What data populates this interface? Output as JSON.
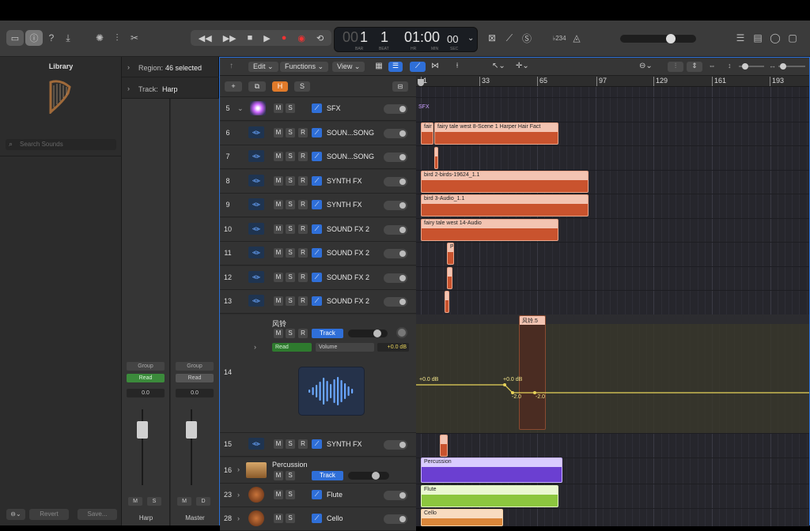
{
  "transport": {
    "bar_dim": "00",
    "bar": "1",
    "beat": "1",
    "time": "01:00",
    "time_small": "00",
    "labels": {
      "bar": "BAR",
      "beat": "BEAT",
      "hr": "HR",
      "min": "MIN",
      "sec": "SEC"
    },
    "key_label": "♭234"
  },
  "library": {
    "title": "Library",
    "search_placeholder": "Search Sounds",
    "revert_label": "Revert",
    "save_label": "Save..."
  },
  "inspector": {
    "region_label": "Region:",
    "region_value": "46 selected",
    "track_label": "Track:",
    "track_value": "Harp",
    "strips": [
      {
        "group": "Group",
        "automation": "Read",
        "value": "0.0",
        "m": "M",
        "s": "S",
        "name": "Harp"
      },
      {
        "group": "Group",
        "automation": "Read",
        "value": "0.0",
        "m": "M",
        "s": "D",
        "name": "Master"
      }
    ]
  },
  "tracks_toolbar": {
    "edit": "Edit",
    "functions": "Functions",
    "view": "View",
    "h_button": "H",
    "s_button": "S"
  },
  "ruler": {
    "ticks": [
      "1",
      "33",
      "65",
      "97",
      "129",
      "161",
      "193"
    ]
  },
  "tracks": [
    {
      "num": "5",
      "name": "SFX"
    },
    {
      "num": "6",
      "name": "SOUN...SONG"
    },
    {
      "num": "7",
      "name": "SOUN...SONG"
    },
    {
      "num": "8",
      "name": "SYNTH FX"
    },
    {
      "num": "9",
      "name": "SYNTH FX"
    },
    {
      "num": "10",
      "name": "SOUND FX 2"
    },
    {
      "num": "11",
      "name": "SOUND FX 2"
    },
    {
      "num": "12",
      "name": "SOUND FX 2"
    },
    {
      "num": "13",
      "name": "SOUND FX 2"
    }
  ],
  "expanded_track": {
    "num": "14",
    "name": "风铃",
    "track_btn": "Track",
    "mode": "Read",
    "param": "Volume",
    "param_value": "+0.0 dB"
  },
  "lower_tracks": [
    {
      "num": "15",
      "name": "SYNTH FX"
    },
    {
      "num": "16",
      "name": "Percussion",
      "track_btn": "Track"
    },
    {
      "num": "23",
      "name": "Flute"
    },
    {
      "num": "28",
      "name": "Cello"
    }
  ],
  "buttons": {
    "m": "M",
    "s": "S",
    "r": "R"
  },
  "regions": {
    "sfx_label": "SFX",
    "fair": "fair",
    "fairy_long": "fairy tale west 8-Scene 1 Harper Hair Fact",
    "bird2": "bird 2-birds-19624_1.1",
    "bird3": "bird 3-Audio_1.1",
    "fairy14": "fairy tale west 14-Audio",
    "p": "P",
    "fengling": "风铃.5",
    "percussion": "Percussion",
    "flute": "Flute",
    "cello": "Cello"
  },
  "automation": {
    "db1": "+0.0 dB",
    "db2": "+0.0 dB",
    "v1": "-2.0",
    "v2": "-2.0"
  },
  "colors": {
    "accent": "#2f6fd8",
    "orange": "#c9532e",
    "purple": "#6b3fd1",
    "green": "#8cc63f",
    "yellow": "#e8d35a"
  }
}
